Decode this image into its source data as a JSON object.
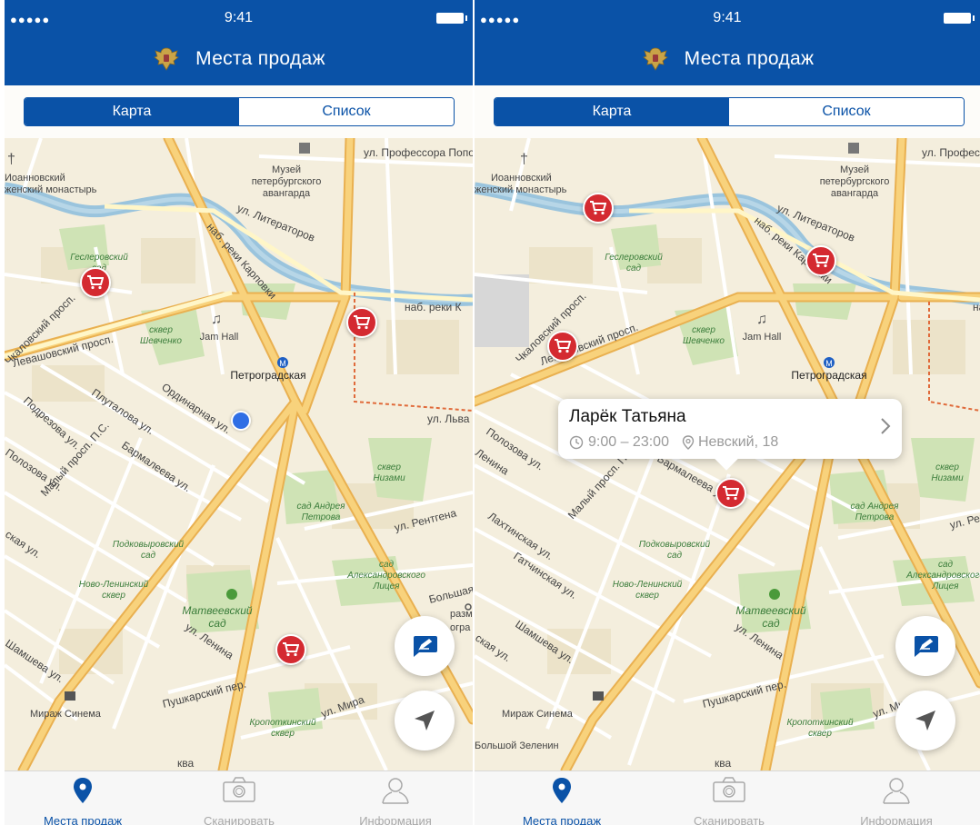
{
  "status": {
    "signal": "●●●●●",
    "time": "9:41"
  },
  "header": {
    "title": "Места продаж"
  },
  "segments": {
    "map": "Карта",
    "list": "Список"
  },
  "map_labels": {
    "prof": "ул. Профессора Попова",
    "prof_short": "ул. Профессора Попова",
    "monastery1": "Иоанновский",
    "monastery2": "женский монастырь",
    "museum1": "Музей",
    "museum2": "петербургского",
    "museum3": "авангарда",
    "literatorov": "ул. Литераторов",
    "karpovka": "наб. реки Карповки",
    "karpovka2": "наб. реки К",
    "gesler1": "Геслеровский",
    "gesler2": "сад",
    "chkalov": "Чкаловский просп.",
    "levash": "Левашовский просп.",
    "shevch1": "сквер",
    "shevch2": "Шевченко",
    "jamhall": "Jam Hall",
    "petrograd": "Петроградская",
    "plutalova": "Плуталова ул.",
    "ordinar": "Ординарная ул.",
    "lva": "ул. Льва Толстого",
    "podrez": "Подрезова ул.",
    "malyi": "Малый просп. П.С.",
    "barmal": "Бармалеева ул.",
    "polozova": "Полозова ул.",
    "lenina": "Ленина",
    "niz1": "сквер",
    "niz2": "Низами",
    "petrov1": "сад Андрея",
    "petrov2": "Петрова",
    "rentgena": "ул. Рентгена",
    "podkov1": "Подковыровский",
    "podkov2": "сад",
    "novolen1": "Ново-Ленинский",
    "novolen2": "сквер",
    "alex1": "сад",
    "alex2": "Александровского",
    "alex3": "Лицея",
    "bolsh": "Большая",
    "matv1": "Матвеевский",
    "matv2": "сад",
    "ullenina": "ул. Ленина",
    "shamsh": "Шамшева ул.",
    "pushk": "Пушкарский пер.",
    "mira": "ул. Мира",
    "kropot1": "Кропоткинский",
    "kropot2": "сквер",
    "mirazh": "Мираж Синема",
    "lakht": "Лахтинская ул.",
    "gatch": "Гатчинская ул.",
    "sk": "ская ул.",
    "ob": "Большой Зеленин",
    "kova": "ква",
    "raz": "разминск",
    "ogr": "огра"
  },
  "callout": {
    "name": "Ларёк Татьяна",
    "hours": "9:00 – 23:00",
    "address": "Невский, 18"
  },
  "tabs": {
    "places": "Места продаж",
    "scan": "Сканировать",
    "info": "Информация"
  },
  "colors": {
    "brand": "#0a52a7",
    "pin": "#d42a31",
    "road_major": "#f5c063",
    "water": "#9ac4dd",
    "park": "#cfe3b5"
  },
  "icons": {
    "emblem": "eagle-emblem-icon",
    "pin": "shopping-cart-icon",
    "feedback": "edit-icon",
    "locate": "location-arrow-icon",
    "places": "map-pin-icon",
    "scan": "camera-icon",
    "info": "person-icon"
  }
}
